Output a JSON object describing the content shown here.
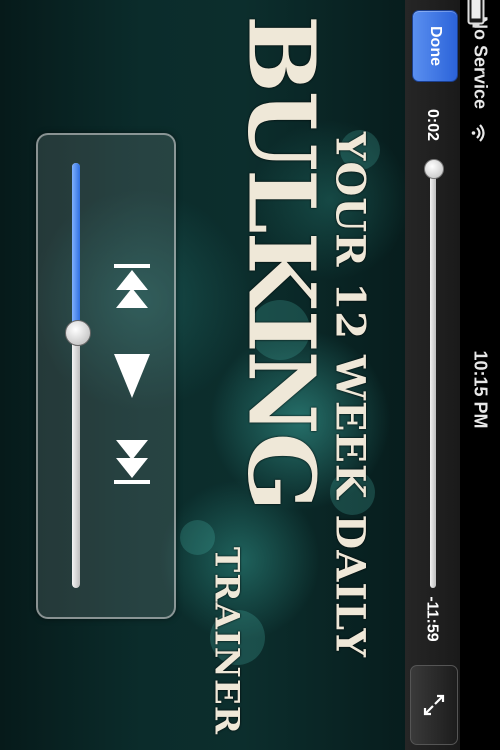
{
  "status_bar": {
    "carrier": "No Service",
    "time": "10:15 PM",
    "wifi_icon": "wifi-icon",
    "battery_icon": "battery-icon"
  },
  "player": {
    "done_label": "Done",
    "elapsed": "0:02",
    "remaining": "-11:59",
    "scrub_progress": 0.003,
    "scale_icon": "expand-arrows-icon"
  },
  "controls": {
    "previous_icon": "skip-back-icon",
    "play_icon": "play-icon",
    "next_icon": "skip-forward-icon",
    "volume_level": 0.4
  },
  "video_title": {
    "line1": "YOUR 12 WEEK DAILY",
    "line2": "BULKING",
    "line3": "TRAINER"
  },
  "colors": {
    "accent": "#2f6fe0",
    "done_button": "#3a73e6"
  }
}
